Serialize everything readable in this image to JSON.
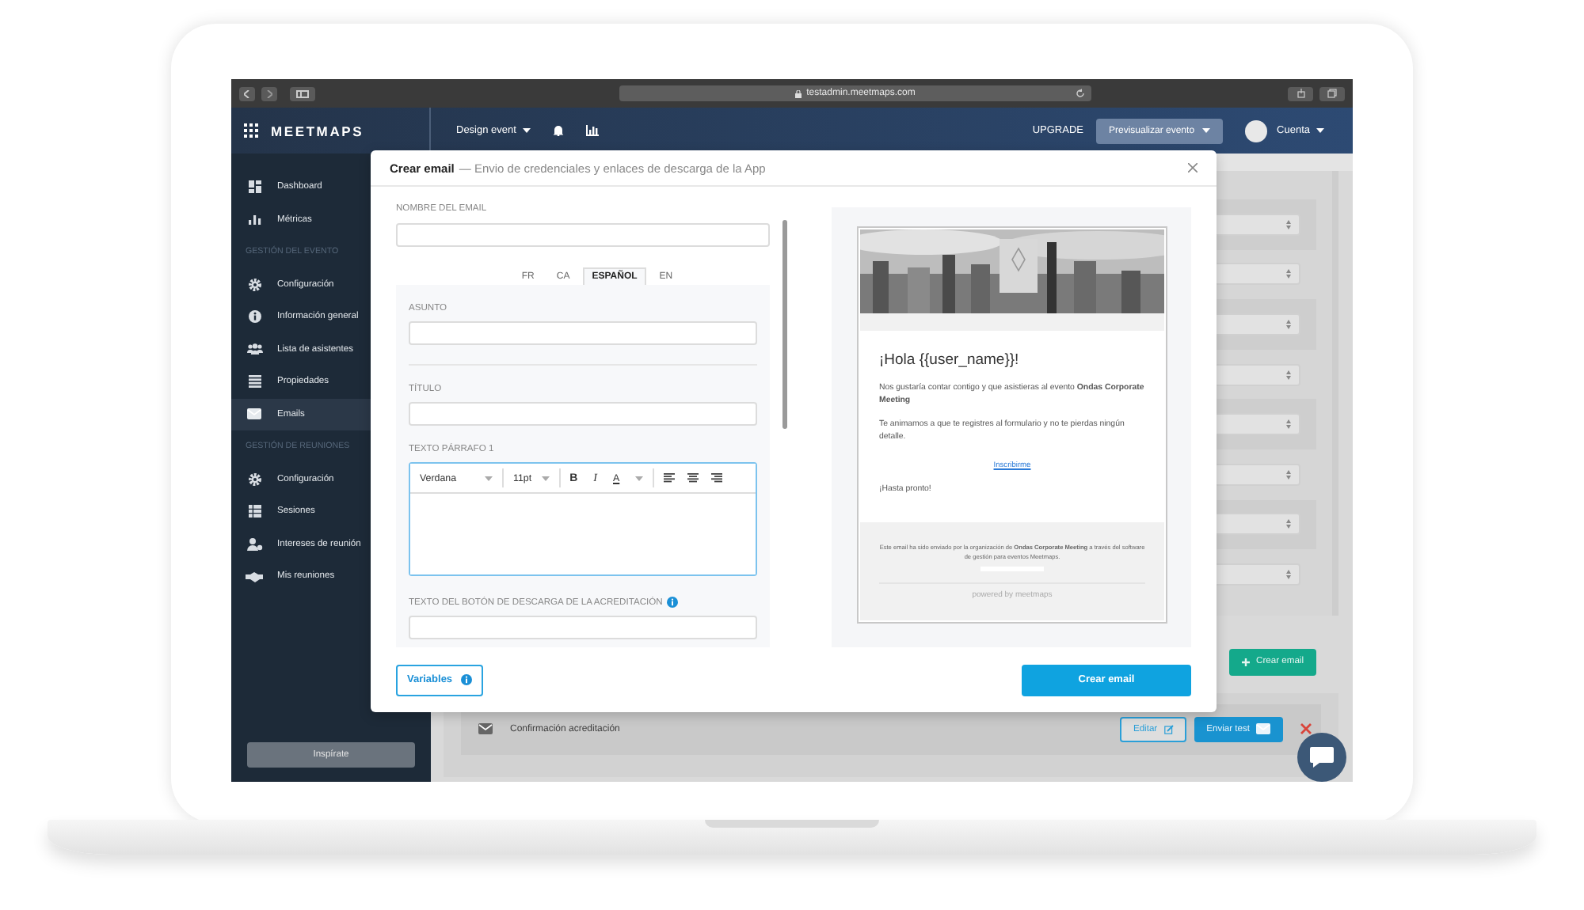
{
  "browser": {
    "url": "testadmin.meetmaps.com"
  },
  "header": {
    "brand": "MEETMAPS",
    "event_menu": "Design event",
    "upgrade": "UPGRADE",
    "preview_button": "Previsualizar evento",
    "account": "Cuenta"
  },
  "sidebar": {
    "items": [
      {
        "kind": "item",
        "label": "Dashboard",
        "selected": false
      },
      {
        "kind": "item",
        "label": "Métricas",
        "selected": false
      },
      {
        "kind": "section",
        "label": "GESTIÓN DEL EVENTO"
      },
      {
        "kind": "item",
        "label": "Configuración",
        "selected": false
      },
      {
        "kind": "item",
        "label": "Información general",
        "selected": false
      },
      {
        "kind": "item",
        "label": "Lista de asistentes",
        "selected": false
      },
      {
        "kind": "item",
        "label": "Propiedades",
        "selected": false
      },
      {
        "kind": "item",
        "label": "Emails",
        "selected": true
      },
      {
        "kind": "section",
        "label": "GESTIÓN DE REUNIONES"
      },
      {
        "kind": "item",
        "label": "Configuración",
        "selected": false
      },
      {
        "kind": "item",
        "label": "Sesiones",
        "selected": false
      },
      {
        "kind": "item",
        "label": "Intereses de reunión",
        "selected": false
      },
      {
        "kind": "item",
        "label": "Mis reuniones",
        "selected": false
      }
    ],
    "button": "Inspírate"
  },
  "main": {
    "create_button": "Crear email",
    "emails": [
      {
        "name": "Confirmación acreditación",
        "edit": "Editar",
        "test": "Enviar test"
      }
    ]
  },
  "modal": {
    "title": "Crear email",
    "subtitle": "— Envio de credenciales y enlaces de descarga de la App",
    "name_label": "NOMBRE DEL EMAIL",
    "languages": [
      {
        "label": "FR",
        "selected": false
      },
      {
        "label": "CA",
        "selected": false
      },
      {
        "label": "ESPAÑOL",
        "selected": true
      },
      {
        "label": "EN",
        "selected": false
      }
    ],
    "subject_label": "ASUNTO",
    "title_label": "TÍTULO",
    "paragraph_label": "TEXTO PÁRRAFO 1",
    "editor": {
      "font": "Verdana",
      "size": "11pt",
      "bold": "B",
      "italic": "I",
      "text_color": "A"
    },
    "button_text_label": "TEXTO DEL BOTÓN DE DESCARGA DE LA ACREDITACIÓN",
    "preview": {
      "greeting": "¡Hola {{user_name}}!",
      "paragraphs": [
        "Nos gustaría contar contigo y que asistieras al evento **Ondas Corporate Meeting**",
        "Te animamos a que te registres al formulario y no te pierdas ningún detalle."
      ],
      "link": "Inscribirme",
      "closing": "¡Hasta pronto!",
      "footer": "Este email ha sido enviado por la organización de **Ondas Corporate Meeting** a través del software de gestión para eventos Meetmaps.",
      "powered": "powered by meetmaps"
    },
    "variables_button": "Variables",
    "submit_button": "Crear email"
  }
}
